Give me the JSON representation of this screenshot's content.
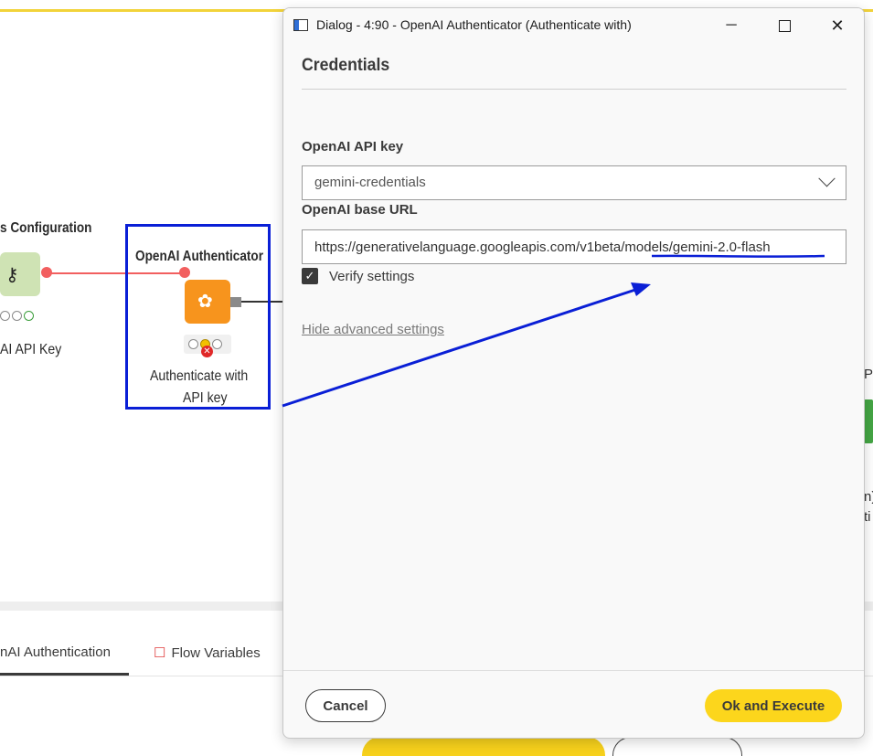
{
  "workflow": {
    "left_node_title": "s Configuration",
    "left_node_label": "AI API Key",
    "selected_node_title": "OpenAI Authenticator",
    "selected_node_label_line1": "Authenticate with",
    "selected_node_label_line2": "API key",
    "right_edge_text1": "P",
    "right_edge_text2": "n)",
    "right_edge_text3": "ti"
  },
  "bottom_panel": {
    "tab1_label": "nAI Authentication",
    "tab2_label": "Flow Variables"
  },
  "dialog": {
    "window_title": "Dialog - 4:90 - OpenAI Authenticator (Authenticate with)",
    "heading": "Credentials",
    "api_key_label": "OpenAI API key",
    "api_key_value": "gemini-credentials",
    "base_url_label": "OpenAI base URL",
    "base_url_value": "https://generativelanguage.googleapis.com/v1beta/models/gemini-2.0-flash",
    "verify_label": "Verify settings",
    "verify_checked": true,
    "advanced_link": "Hide advanced settings",
    "cancel_label": "Cancel",
    "ok_label": "Ok and Execute"
  },
  "colors": {
    "accent_yellow": "#fcd61c",
    "annotation_blue": "#0a1fd6",
    "node_orange": "#f7941d",
    "connection_red": "#f25f5f"
  }
}
